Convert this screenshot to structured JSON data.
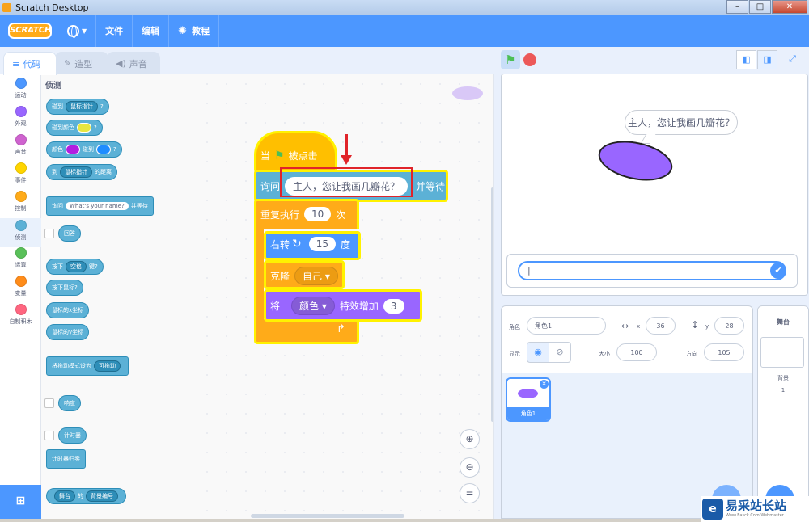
{
  "window": {
    "title": "Scratch Desktop",
    "controls": [
      "–",
      "□",
      "✕"
    ]
  },
  "menubar": {
    "logo": "SCRATCH",
    "file": "文件",
    "edit": "编辑",
    "tutorials": "教程"
  },
  "tabs": [
    {
      "label": "代码",
      "icon": "code-icon"
    },
    {
      "label": "造型",
      "icon": "brush-icon"
    },
    {
      "label": "声音",
      "icon": "speaker-icon"
    }
  ],
  "categories": [
    {
      "label": "运动",
      "color": "#4c97ff"
    },
    {
      "label": "外观",
      "color": "#9966ff"
    },
    {
      "label": "声音",
      "color": "#cf63cf"
    },
    {
      "label": "事件",
      "color": "#ffd500"
    },
    {
      "label": "控制",
      "color": "#ffab19"
    },
    {
      "label": "侦测",
      "color": "#5cb1d6"
    },
    {
      "label": "运算",
      "color": "#59c059"
    },
    {
      "label": "变量",
      "color": "#ff8c1a"
    },
    {
      "label": "自制积木",
      "color": "#ff6680"
    }
  ],
  "palette": {
    "title": "侦测",
    "touching": "碰到",
    "touching_menu": "鼠标指针",
    "q": "?",
    "touching_color": "碰到颜色",
    "color": "颜色",
    "touch": "碰到",
    "to": "到",
    "distance": "的距离",
    "ask": "询问",
    "ask_default": "What's your name?",
    "and_wait": "并等待",
    "answer": "回答",
    "key": "按下",
    "key_menu": "空格",
    "key_suffix": "键?",
    "mouse_down": "按下鼠标?",
    "mouse_x": "鼠标的x坐标",
    "mouse_y": "鼠标的y坐标",
    "drag_mode": "将拖动模式设为",
    "drag_menu": "可拖动",
    "loudness": "响度",
    "timer": "计时器",
    "reset_timer": "计时器归零",
    "of_stage": "舞台",
    "of": "的",
    "of_prop": "背景编号"
  },
  "script": {
    "when": "当",
    "clicked": "被点击",
    "ask": "询问",
    "ask_text": "主人，您让我画几瓣花？",
    "wait": "并等待",
    "repeat": "重复执行",
    "repeat_count": "10",
    "times": "次",
    "turn": "右转",
    "turn_deg": "15",
    "degree": "度",
    "clone": "克隆",
    "clone_target": "自己",
    "effect_a": "将",
    "effect_name": "颜色",
    "effect_b": "特效增加",
    "effect_val": "3"
  },
  "stage": {
    "speech": "主人，您让我画几瓣花？",
    "answer_value": "|"
  },
  "sprite_info": {
    "sprite_label": "角色",
    "sprite_name": "角色1",
    "x_label": "x",
    "x": "36",
    "y_label": "y",
    "y": "28",
    "show_label": "显示",
    "size_label": "大小",
    "size": "100",
    "direction_label": "方向",
    "direction": "105"
  },
  "sprites": [
    {
      "name": "角色1"
    }
  ],
  "stage_pane": {
    "title": "舞台",
    "backdrops_label": "背景",
    "backdrops_count": "1"
  },
  "watermark": {
    "main": "易采站长站",
    "sub": "Www.Easck.Com  Webmaster"
  }
}
